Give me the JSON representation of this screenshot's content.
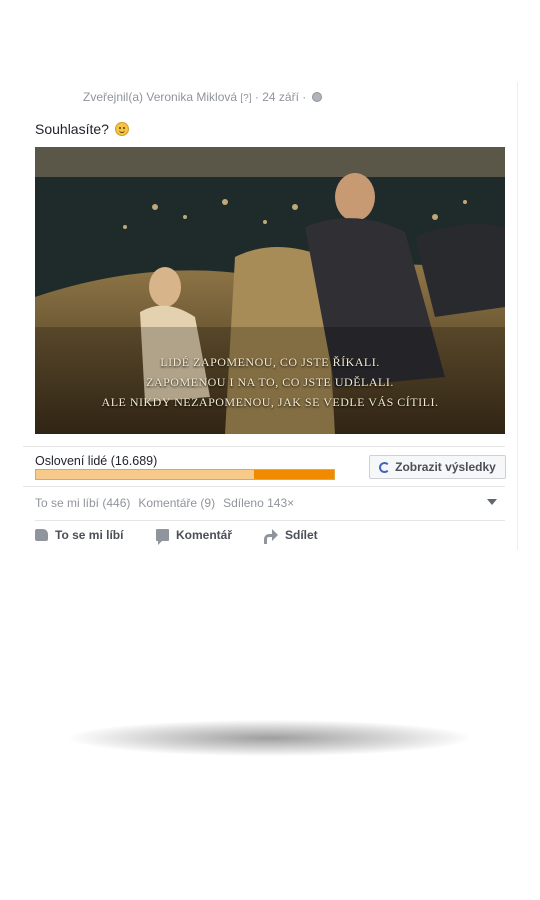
{
  "post": {
    "author_line": "Zveřejnil(a) Veronika Miklová",
    "help_marker": "[?]",
    "date": "24 září",
    "status_text": "Souhlasíte?",
    "photo_caption": [
      "LIDÉ ZAPOMENOU, CO JSTE ŘÍKALI.",
      "ZAPOMENOU I NA TO, CO JSTE UDĚLALI.",
      "ALE NIKDY NEZAPOMENOU, JAK SE VEDLE VÁS CÍTILI."
    ]
  },
  "reach": {
    "label": "Oslovení lidé (16.689)",
    "paid_fraction": 0.27,
    "results_button": "Zobrazit výsledky"
  },
  "stats": {
    "likes": "To se mi líbí (446)",
    "comments": "Komentáře (9)",
    "shares": "Sdíleno 143×"
  },
  "actions": {
    "like": "To se mi líbí",
    "comment": "Komentář",
    "share": "Sdílet"
  },
  "colors": {
    "bar_paid": "#f08b00",
    "bar_organic": "#f7c98a",
    "accent": "#4267b2"
  },
  "icons": [
    "globe-icon",
    "smiley-icon",
    "refresh-icon",
    "caret-down-icon",
    "thumbs-up-icon",
    "comment-icon",
    "share-icon"
  ]
}
